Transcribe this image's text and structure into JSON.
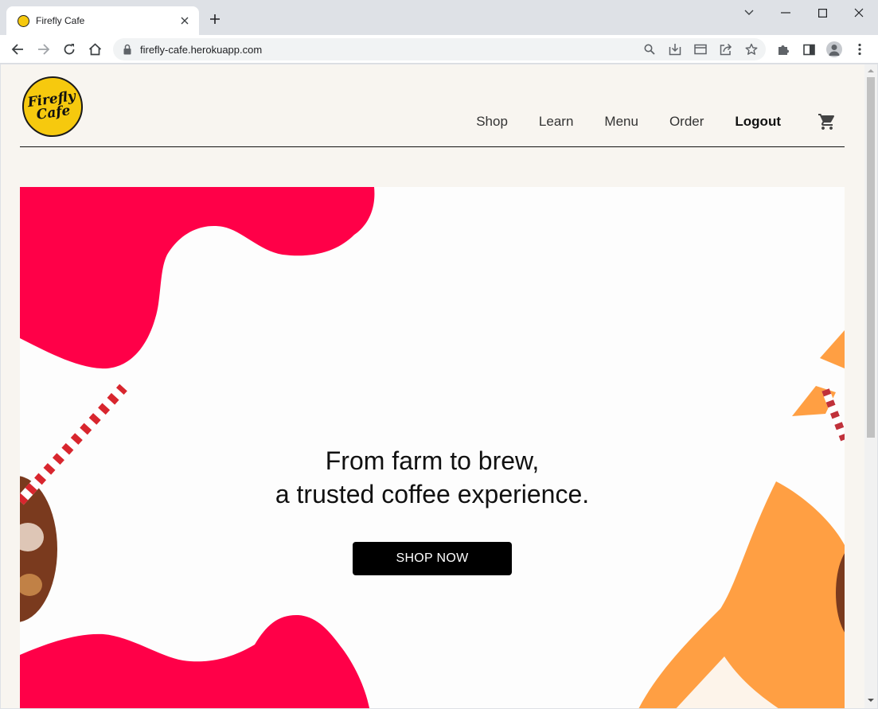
{
  "browser": {
    "tab_title": "Firefly Cafe",
    "url": "firefly-cafe.herokuapp.com"
  },
  "site": {
    "logo": {
      "line1": "Firefly",
      "line2": "Cafe"
    },
    "nav": [
      {
        "label": "Shop"
      },
      {
        "label": "Learn"
      },
      {
        "label": "Menu"
      },
      {
        "label": "Order"
      },
      {
        "label": "Logout"
      }
    ],
    "hero": {
      "headline_line1": "From farm to brew,",
      "headline_line2": "a trusted coffee experience.",
      "cta": "SHOP NOW"
    }
  },
  "colors": {
    "accent_red": "#ff0048",
    "accent_orange": "#ff9f43",
    "logo_yellow": "#f6c90e",
    "page_bg": "#f8f5f0"
  }
}
